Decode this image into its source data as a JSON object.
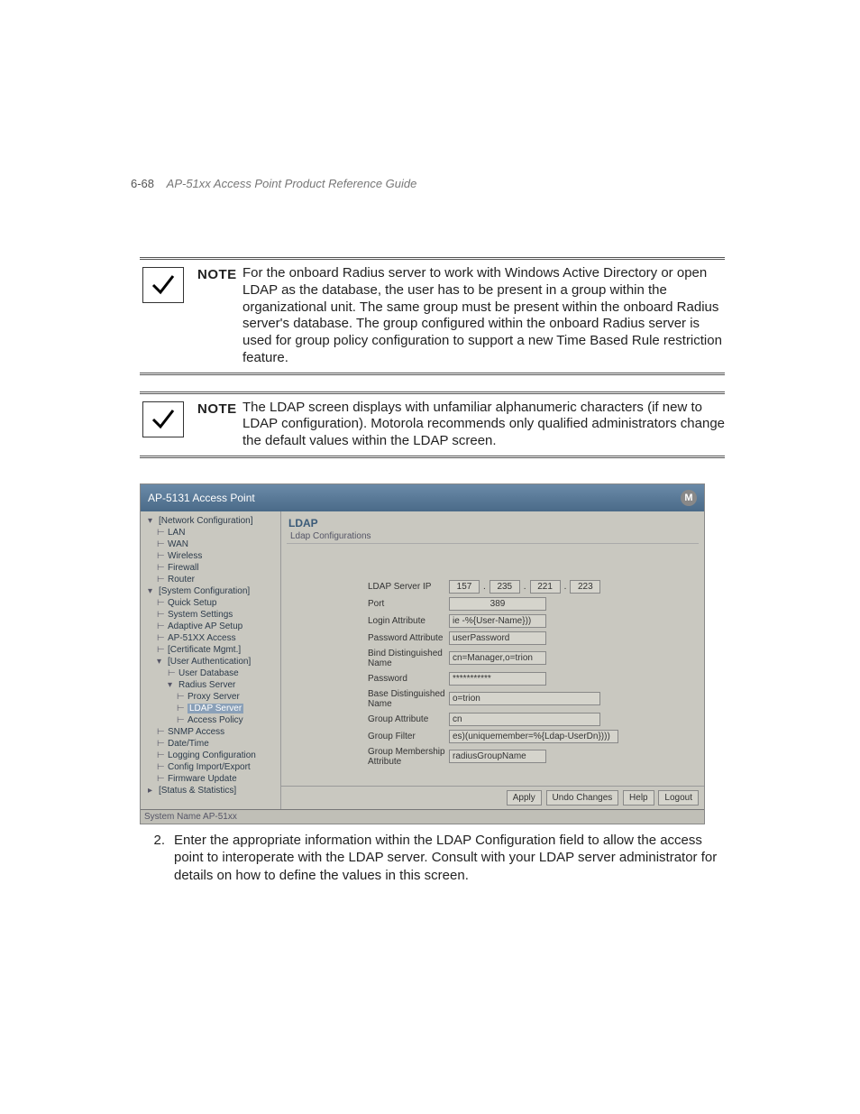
{
  "header": {
    "page_num": "6-68",
    "doc_title": "AP-51xx Access Point Product Reference Guide"
  },
  "notes": {
    "label": "NOTE",
    "n1": "For the onboard Radius server to work with Windows Active Directory or open LDAP as the database, the user has to be present in a group within the organizational unit. The same group must be present within the onboard Radius server's database. The group configured within the onboard Radius server is used for group policy configuration to support a new Time Based Rule restriction feature.",
    "n2": "The LDAP screen displays with unfamiliar alphanumeric characters (if new to LDAP configuration). Motorola recommends only qualified administrators change the default values within the LDAP screen."
  },
  "shot": {
    "title": "AP-5131 Access Point",
    "nav": {
      "network": "[Network Configuration]",
      "lan": "LAN",
      "wan": "WAN",
      "wireless": "Wireless",
      "firewall": "Firewall",
      "router": "Router",
      "system": "[System Configuration]",
      "quick": "Quick Setup",
      "settings": "System Settings",
      "adaptive": "Adaptive AP Setup",
      "ap51xx": "AP-51XX Access",
      "cert": "[Certificate Mgmt.]",
      "userauth": "[User Authentication]",
      "userdb": "User Database",
      "radius": "Radius Server",
      "proxy": "Proxy Server",
      "ldap": "LDAP Server",
      "policy": "Access Policy",
      "snmp": "SNMP Access",
      "datetime": "Date/Time",
      "logging": "Logging Configuration",
      "config": "Config Import/Export",
      "firmware": "Firmware Update",
      "stats": "[Status & Statistics]"
    },
    "main": {
      "title": "LDAP",
      "fieldset": "Ldap Configurations",
      "rows": {
        "server_ip_label": "LDAP Server IP",
        "ip": {
          "a": "157",
          "b": "235",
          "c": "221",
          "d": "223"
        },
        "port_label": "Port",
        "port": "389",
        "login_attr_label": "Login Attribute",
        "login_attr": "ie -%{User-Name}))",
        "pwd_attr_label": "Password Attribute",
        "pwd_attr": "userPassword",
        "bind_dn_label": "Bind Distinguished Name",
        "bind_dn": "cn=Manager,o=trion",
        "password_label": "Password",
        "password": "***********",
        "base_dn_label": "Base Distinguished Name",
        "base_dn": "o=trion",
        "group_attr_label": "Group Attribute",
        "group_attr": "cn",
        "group_filter_label": "Group Filter",
        "group_filter": "es)(uniquemember=%{Ldap-UserDn})))",
        "group_mem_label": "Group Membership Attribute",
        "group_mem": "radiusGroupName"
      }
    },
    "footer": {
      "apply": "Apply",
      "undo": "Undo Changes",
      "help": "Help",
      "logout": "Logout"
    },
    "sysname": "System Name AP-51xx"
  },
  "step": {
    "num": "2.",
    "text": "Enter the appropriate information within the LDAP Configuration field to allow the access point to interoperate with the LDAP server. Consult with your LDAP server administrator for details on how to define the values in this screen."
  }
}
